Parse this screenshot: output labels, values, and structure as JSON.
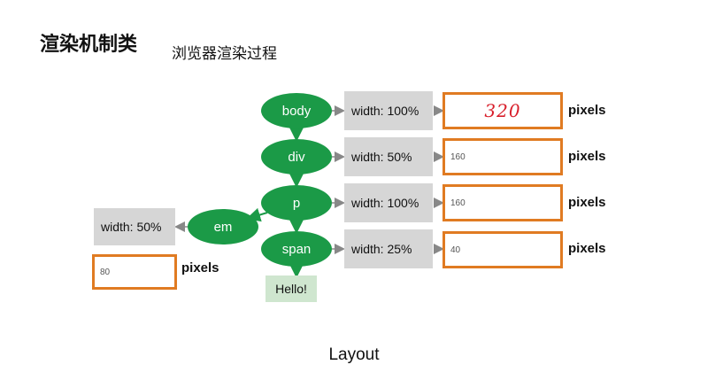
{
  "header": {
    "title": "渲染机制类",
    "subtitle": "浏览器渲染过程"
  },
  "tree": {
    "nodes": {
      "body": "body",
      "div": "div",
      "p": "p",
      "em": "em",
      "span": "span"
    },
    "text_node": "Hello!"
  },
  "styles": {
    "body": "width: 100%",
    "div": "width: 50%",
    "p": "width: 100%",
    "em": "width: 50%",
    "span": "width: 25%"
  },
  "computed": {
    "body": "320",
    "div": "160",
    "p": "160",
    "em": "80",
    "span": "40",
    "unit": "pixels"
  },
  "caption": "Layout",
  "colors": {
    "node": "#1b9a47",
    "style_box": "#d6d6d6",
    "pixel_border": "#e07b22",
    "handwritten": "#d81e2a",
    "text_leaf": "#cfe6cf"
  }
}
